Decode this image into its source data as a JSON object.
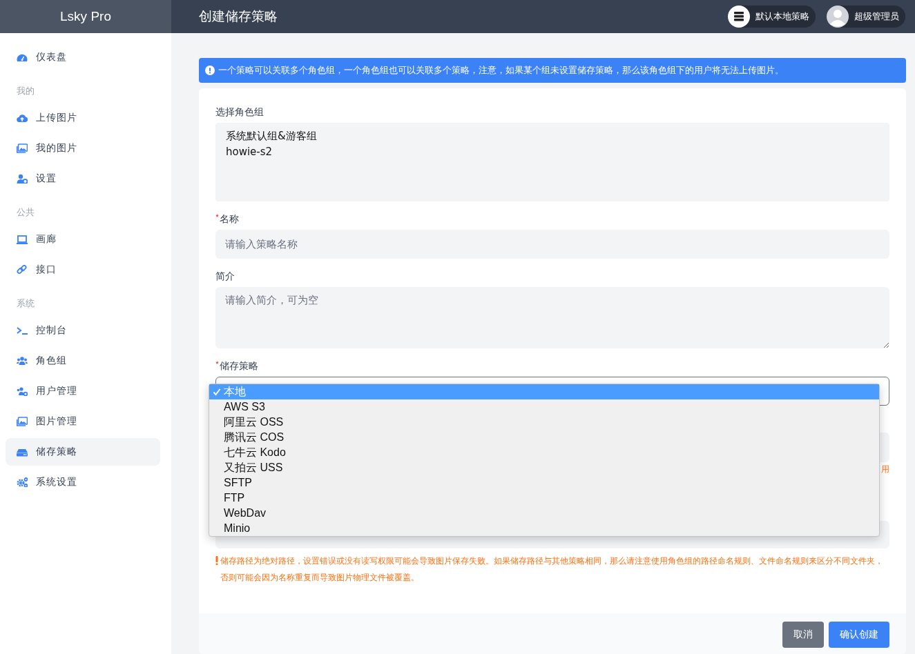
{
  "header": {
    "logo": "Lsky Pro",
    "title": "创建储存策略",
    "strategy_button": "默认本地策略",
    "user_button": "超级管理员"
  },
  "sidebar": [
    {
      "kind": "item",
      "label": "仪表盘",
      "selected": false
    },
    {
      "kind": "section",
      "label": "我的"
    },
    {
      "kind": "item",
      "label": "上传图片",
      "selected": false
    },
    {
      "kind": "item",
      "label": "我的图片",
      "selected": false
    },
    {
      "kind": "item",
      "label": "设置",
      "selected": false
    },
    {
      "kind": "section",
      "label": "公共"
    },
    {
      "kind": "item",
      "label": "画廊",
      "selected": false
    },
    {
      "kind": "item",
      "label": "接口",
      "selected": false
    },
    {
      "kind": "section",
      "label": "系统"
    },
    {
      "kind": "item",
      "label": "控制台",
      "selected": false
    },
    {
      "kind": "item",
      "label": "角色组",
      "selected": false
    },
    {
      "kind": "item",
      "label": "用户管理",
      "selected": false
    },
    {
      "kind": "item",
      "label": "图片管理",
      "selected": false
    },
    {
      "kind": "item",
      "label": "储存策略",
      "selected": true
    },
    {
      "kind": "item",
      "label": "系统设置",
      "selected": false
    }
  ],
  "alert": {
    "text": "一个策略可以关联多个角色组，一个角色组也可以关联多个策略，注意，如果某个组未设置储存策略，那么该角色组下的用户将无法上传图片。"
  },
  "form": {
    "fields": [
      {
        "kind": "listbox",
        "label": "选择角色组",
        "required": false,
        "options": [
          "系统默认组&游客组",
          "howie-s2"
        ]
      },
      {
        "kind": "input",
        "label": "名称",
        "required": true,
        "placeholder": "请输入策略名称"
      },
      {
        "kind": "textarea",
        "label": "简介",
        "required": false,
        "placeholder": "请输入简介，可为空"
      },
      {
        "kind": "select",
        "label": "储存策略",
        "required": true,
        "options": [
          {
            "label": "本地",
            "selected": true
          },
          {
            "label": "AWS S3",
            "selected": false
          },
          {
            "label": "阿里云 OSS",
            "selected": false
          },
          {
            "label": "腾讯云 COS",
            "selected": false
          },
          {
            "label": "七牛云 Kodo",
            "selected": false
          },
          {
            "label": "又拍云 USS",
            "selected": false
          },
          {
            "label": "SFTP",
            "selected": false
          },
          {
            "label": "FTP",
            "selected": false
          },
          {
            "label": "WebDav",
            "selected": false
          },
          {
            "label": "Minio",
            "selected": false
          }
        ]
      },
      {
        "kind": "covered",
        "hint": "用"
      },
      {
        "kind": "covered",
        "warning": "储存路径为绝对路径，设置错误或没有读写权限可能会导致图片保存失败。如果储存路径与其他策略相同，那么请注意使用角色组的路径命名规则、文件命名规则来区分不同文件夹，否则可能会因为名称重复而导致图片物理文件被覆盖。"
      }
    ]
  },
  "buttons": [
    {
      "kind": "secondary",
      "label": "取消"
    },
    {
      "kind": "primary",
      "label": "确认创建"
    }
  ]
}
